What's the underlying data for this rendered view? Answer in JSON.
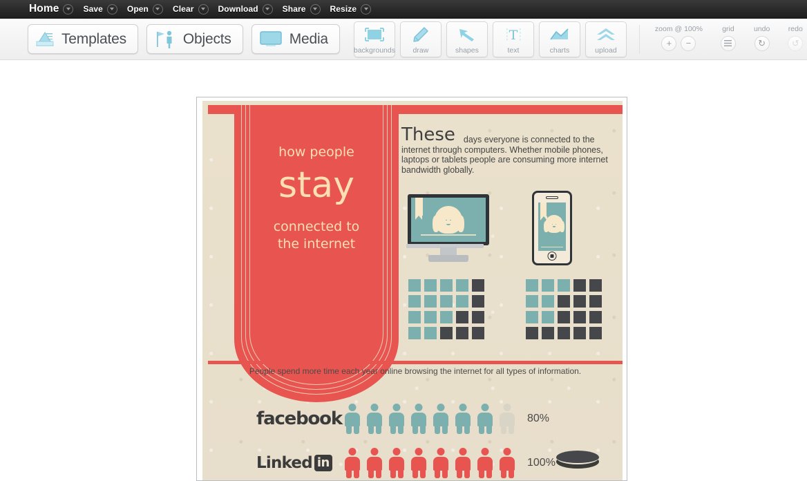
{
  "menubar": {
    "items": [
      {
        "label": "Home",
        "caret": "chevron-down-icon"
      },
      {
        "label": "Save",
        "caret": "chevron-down-icon"
      },
      {
        "label": "Open",
        "caret": "chevron-down-icon"
      },
      {
        "label": "Clear",
        "caret": "chevron-down-icon"
      },
      {
        "label": "Download",
        "caret": "chevron-down-icon"
      },
      {
        "label": "Share",
        "caret": "chevron-down-icon"
      },
      {
        "label": "Resize",
        "caret": "chevron-down-icon"
      }
    ]
  },
  "toolbar": {
    "primary": [
      {
        "label": "Templates",
        "icon": "chart-triangle-icon"
      },
      {
        "label": "Objects",
        "icon": "person-flag-icon"
      },
      {
        "label": "Media",
        "icon": "monitor-icon"
      }
    ],
    "tools": [
      {
        "label": "backgrounds",
        "icon": "background-frame-icon"
      },
      {
        "label": "draw",
        "icon": "pencil-icon"
      },
      {
        "label": "shapes",
        "icon": "arrow-icon"
      },
      {
        "label": "text",
        "icon": "text-t-icon"
      },
      {
        "label": "charts",
        "icon": "line-chart-icon"
      },
      {
        "label": "upload",
        "icon": "upload-chevrons-icon"
      }
    ],
    "zoom": {
      "title": "zoom @ 100%",
      "level": "100%",
      "in_label": "+",
      "out_label": "−"
    },
    "grid": {
      "title": "grid",
      "icon": "hamburger-icon"
    },
    "undo": {
      "title": "undo",
      "icon": "undo-arrow-icon",
      "glyph": "↻"
    },
    "redo": {
      "title": "redo",
      "icon": "redo-arrow-icon",
      "glyph": "↺",
      "disabled": true
    }
  },
  "poster": {
    "colors": {
      "paper": "#e9e0cb",
      "red": "#e8544f",
      "teal": "#7bb0ae",
      "dark": "#46474a",
      "cream": "#f6e8c8"
    },
    "ribbon": {
      "line1": "how people",
      "line2": "stay",
      "line3": "connected to",
      "line4": "the internet"
    },
    "intro": {
      "lead": "These",
      "body": "days everyone is connected to the internet through computers. Whether mobile phones, laptops or tablets people are consuming more internet bandwidth globally."
    },
    "devices": {
      "monitor_label": "desktop-computer",
      "phone_label": "mobile-phone"
    },
    "grid_left": {
      "columns": 5,
      "rows": 4,
      "cells": [
        [
          "teal",
          "teal",
          "teal",
          "teal",
          "dark"
        ],
        [
          "teal",
          "teal",
          "teal",
          "teal",
          "dark"
        ],
        [
          "teal",
          "teal",
          "teal",
          "dark",
          "dark"
        ],
        [
          "teal",
          "teal",
          "dark",
          "dark",
          "dark"
        ]
      ]
    },
    "grid_right": {
      "columns": 5,
      "rows": 4,
      "cells": [
        [
          "teal",
          "teal",
          "teal",
          "dark",
          "dark"
        ],
        [
          "teal",
          "teal",
          "dark",
          "dark",
          "dark"
        ],
        [
          "teal",
          "teal",
          "dark",
          "dark",
          "dark"
        ],
        [
          "dark",
          "dark",
          "dark",
          "dark",
          "dark"
        ]
      ]
    },
    "divider_caption": "People spend more time each year online browsing the internet for all types of  information.",
    "social": [
      {
        "name": "facebook",
        "logo_text": "facebook",
        "percent": "80%",
        "total_icons": 8,
        "filled_icons": 7,
        "fill_color": "#7bb0ae",
        "empty_color": "#d8d4c6"
      },
      {
        "name": "linkedin",
        "logo_text": "Linked",
        "logo_badge": "in",
        "percent": "100%",
        "total_icons": 8,
        "filled_icons": 8,
        "fill_color": "#e8544f",
        "empty_color": "#d8d4c6"
      }
    ]
  },
  "chart_data": {
    "type": "bar",
    "title": "how people stay connected to the internet",
    "subtitle": "People spend more time each year online browsing the internet for all types of  information.",
    "categories": [
      "facebook",
      "LinkedIn"
    ],
    "values": [
      80,
      100
    ],
    "value_labels": [
      "80%",
      "100%"
    ],
    "unit": "percent",
    "ylim": [
      0,
      100
    ],
    "xlabel": "",
    "ylabel": "",
    "grid": false,
    "legend": "none",
    "pictogram": {
      "icon": "person",
      "icons_per_row": 8,
      "value_per_icon": 12.5
    },
    "waffle_charts": [
      {
        "name": "desktop-computer",
        "columns": 5,
        "rows": 4,
        "filled": 13,
        "total": 20,
        "percent": 65,
        "fill_color": "#7bb0ae",
        "empty_color": "#46474a"
      },
      {
        "name": "mobile-phone",
        "columns": 5,
        "rows": 4,
        "filled": 7,
        "total": 20,
        "percent": 35,
        "fill_color": "#7bb0ae",
        "empty_color": "#46474a"
      }
    ]
  }
}
